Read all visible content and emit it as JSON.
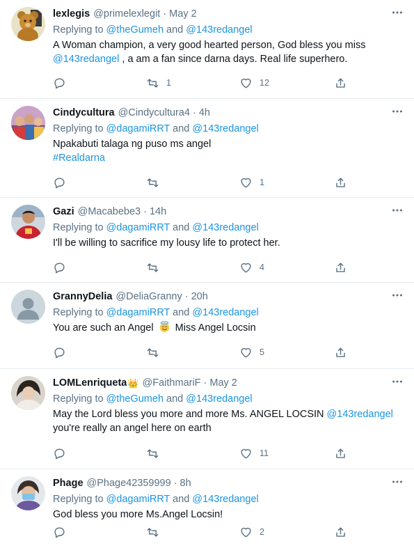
{
  "tweets": [
    {
      "name": "lexlegis",
      "handle": "@primelexlegit",
      "dot": "·",
      "time": "May 2",
      "reply_prefix": "Replying to",
      "reply_mention_1": "@theGumeh",
      "reply_and": "and",
      "reply_mention_2": "@143redangel",
      "text_1": "A Woman champion, a very good hearted person, God bless you miss",
      "text_mention": "@143redangel",
      "text_2": ", a am a fan since darna days. Real life superhero.",
      "reply_count": "",
      "retweet_count": "1",
      "like_count": "12",
      "avatar": "teddy-bear-avatar"
    },
    {
      "name": "Cindycultura",
      "handle": "@Cindycultura4",
      "dot": "·",
      "time": "4h",
      "reply_prefix": "Replying to",
      "reply_mention_1": "@dagamiRRT",
      "reply_and": "and",
      "reply_mention_2": "@143redangel",
      "text_1": "Npakabuti talaga ng puso ms angel",
      "hashtag": "#Realdarna",
      "reply_count": "",
      "retweet_count": "",
      "like_count": "1",
      "avatar": "group-photo-avatar"
    },
    {
      "name": "Gazi",
      "handle": "@Macabebe3",
      "dot": "·",
      "time": "14h",
      "reply_prefix": "Replying to",
      "reply_mention_1": "@dagamiRRT",
      "reply_and": "and",
      "reply_mention_2": "@143redangel",
      "text_1": "I'll be willing to sacrifice my lousy life to protect her.",
      "reply_count": "",
      "retweet_count": "",
      "like_count": "4",
      "avatar": "athlete-avatar"
    },
    {
      "name": "GrannyDelia",
      "handle": "@DeliaGranny",
      "dot": "·",
      "time": "20h",
      "reply_prefix": "Replying to",
      "reply_mention_1": "@dagamiRRT",
      "reply_and": "and",
      "reply_mention_2": "@143redangel",
      "text_1": "You are such an Angel",
      "emoji": "smiling-face-with-halo-emoji",
      "text_2": "Miss Angel Locsin",
      "reply_count": "",
      "retweet_count": "",
      "like_count": "5",
      "avatar": "default-profile-avatar"
    },
    {
      "name": "LOMLenriqueta",
      "name_badge": "👑",
      "handle": "@FaithmariF",
      "dot": "·",
      "time": "May 2",
      "reply_prefix": "Replying to",
      "reply_mention_1": "@theGumeh",
      "reply_and": "and",
      "reply_mention_2": "@143redangel",
      "text_1": "May the Lord bless you more and more Ms. ANGEL LOCSIN",
      "text_mention": "@143redangel",
      "text_2": "you're really an angel here on earth",
      "reply_count": "",
      "retweet_count": "",
      "like_count": "11",
      "avatar": "portrait-avatar"
    },
    {
      "name": "Phage",
      "handle": "@Phage42359999",
      "dot": "·",
      "time": "8h",
      "reply_prefix": "Replying to",
      "reply_mention_1": "@dagamiRRT",
      "reply_and": "and",
      "reply_mention_2": "@143redangel",
      "text_1": "God bless you more Ms.Angel Locsin!",
      "reply_count": "",
      "retweet_count": "",
      "like_count": "2",
      "avatar": "masked-person-avatar"
    }
  ],
  "colors": {
    "link": "#1b95e0",
    "secondary_text": "#5b7083",
    "primary_text": "#0f1419",
    "divider": "#e6ecf0"
  },
  "icons": {
    "reply": "reply-icon",
    "retweet": "retweet-icon",
    "like": "heart-icon",
    "share": "share-icon",
    "more": "more-options-icon"
  }
}
